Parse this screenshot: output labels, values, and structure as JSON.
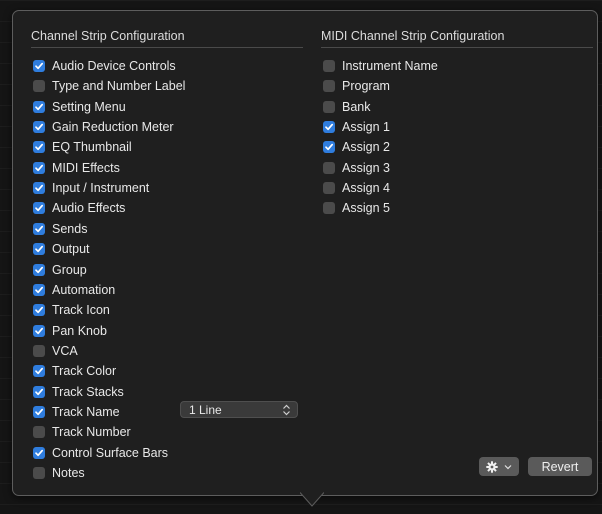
{
  "channel_strip": {
    "title": "Channel Strip Configuration",
    "items": [
      {
        "label": "Audio Device Controls",
        "checked": true
      },
      {
        "label": "Type and Number Label",
        "checked": false
      },
      {
        "label": "Setting Menu",
        "checked": true
      },
      {
        "label": "Gain Reduction Meter",
        "checked": true
      },
      {
        "label": "EQ Thumbnail",
        "checked": true
      },
      {
        "label": "MIDI Effects",
        "checked": true
      },
      {
        "label": "Input / Instrument",
        "checked": true
      },
      {
        "label": "Audio Effects",
        "checked": true
      },
      {
        "label": "Sends",
        "checked": true
      },
      {
        "label": "Output",
        "checked": true
      },
      {
        "label": "Group",
        "checked": true
      },
      {
        "label": "Automation",
        "checked": true
      },
      {
        "label": "Track Icon",
        "checked": true
      },
      {
        "label": "Pan Knob",
        "checked": true
      },
      {
        "label": "VCA",
        "checked": false
      },
      {
        "label": "Track Color",
        "checked": true
      },
      {
        "label": "Track Stacks",
        "checked": true
      },
      {
        "label": "Track Name",
        "checked": true
      },
      {
        "label": "Track Number",
        "checked": false
      },
      {
        "label": "Control Surface Bars",
        "checked": true
      },
      {
        "label": "Notes",
        "checked": false
      }
    ],
    "track_name_lines": "1 Line"
  },
  "midi_strip": {
    "title": "MIDI Channel Strip Configuration",
    "items": [
      {
        "label": "Instrument Name",
        "checked": false
      },
      {
        "label": "Program",
        "checked": false
      },
      {
        "label": "Bank",
        "checked": false
      },
      {
        "label": "Assign 1",
        "checked": true
      },
      {
        "label": "Assign 2",
        "checked": true
      },
      {
        "label": "Assign 3",
        "checked": false
      },
      {
        "label": "Assign 4",
        "checked": false
      },
      {
        "label": "Assign 5",
        "checked": false
      }
    ]
  },
  "footer": {
    "gear_icon": "gear-icon",
    "revert_label": "Revert"
  },
  "colors": {
    "checkbox_on": "#2f7dde",
    "checkbox_off": "#4b4b4b",
    "panel": "#1f1f1f"
  }
}
